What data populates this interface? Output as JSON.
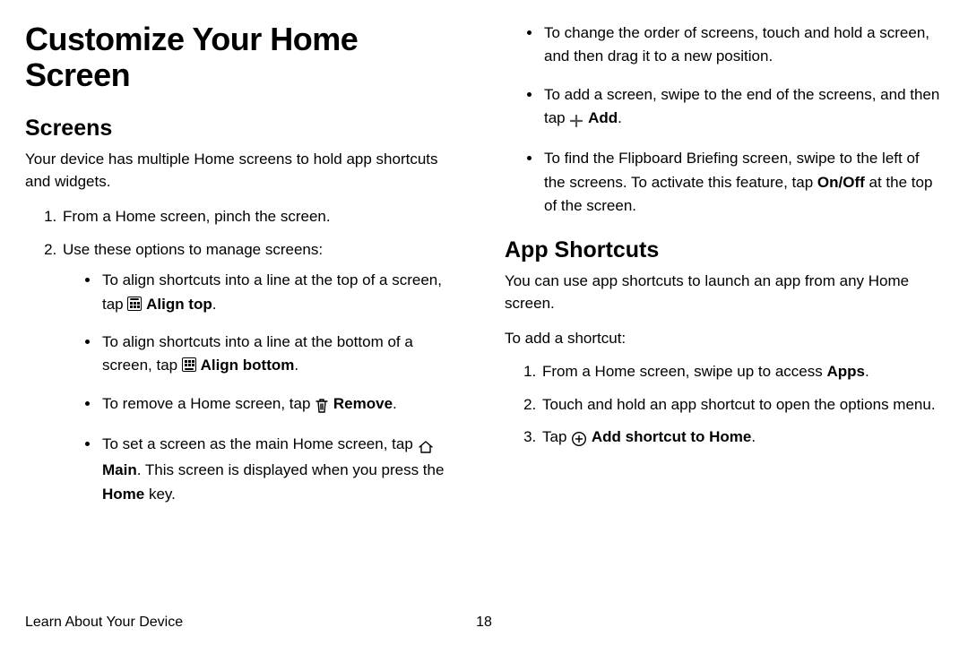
{
  "title": "Customize Your Home Screen",
  "footer_section": "Learn About Your Device",
  "footer_page": "18",
  "left": {
    "h2": "Screens",
    "intro": "Your device has multiple Home screens to hold app shortcuts and widgets.",
    "step1": "From a Home screen, pinch the screen.",
    "step2": "Use these options to manage screens:",
    "b1_pre": "To align shortcuts into a line at the top of a screen, tap ",
    "b1_bold": "Align top",
    "b2_pre": "To align shortcuts into a line at the bottom of a screen, tap ",
    "b2_bold": "Align bottom",
    "b3_pre": "To remove a Home screen, tap ",
    "b3_bold": "Remove",
    "b4_pre": "To set a screen as the main Home screen, tap ",
    "b4_bold": "Main",
    "b4_post1": ". This screen is displayed when you press the ",
    "b4_bold2": "Home",
    "b4_post2": " key."
  },
  "right": {
    "b5": "To change the order of screens, touch and hold a screen, and then drag it to a new position.",
    "b6_pre": "To add a screen, swipe to the end of the screens, and then tap ",
    "b6_bold": "Add",
    "b7_pre": "To find the Flipboard Briefing screen, swipe to the left of the screens. To activate this feature, tap ",
    "b7_bold": "On/Off",
    "b7_post": " at the top of the screen.",
    "h2b": "App Shortcuts",
    "intro2": "You can use app shortcuts to launch an app from any Home screen.",
    "lead": "To add a shortcut:",
    "s1_pre": "From a Home screen, swipe up to access ",
    "s1_bold": "Apps",
    "s2": "Touch and hold an app shortcut to open the options menu.",
    "s3_pre": "Tap ",
    "s3_bold": "Add shortcut to Home"
  }
}
